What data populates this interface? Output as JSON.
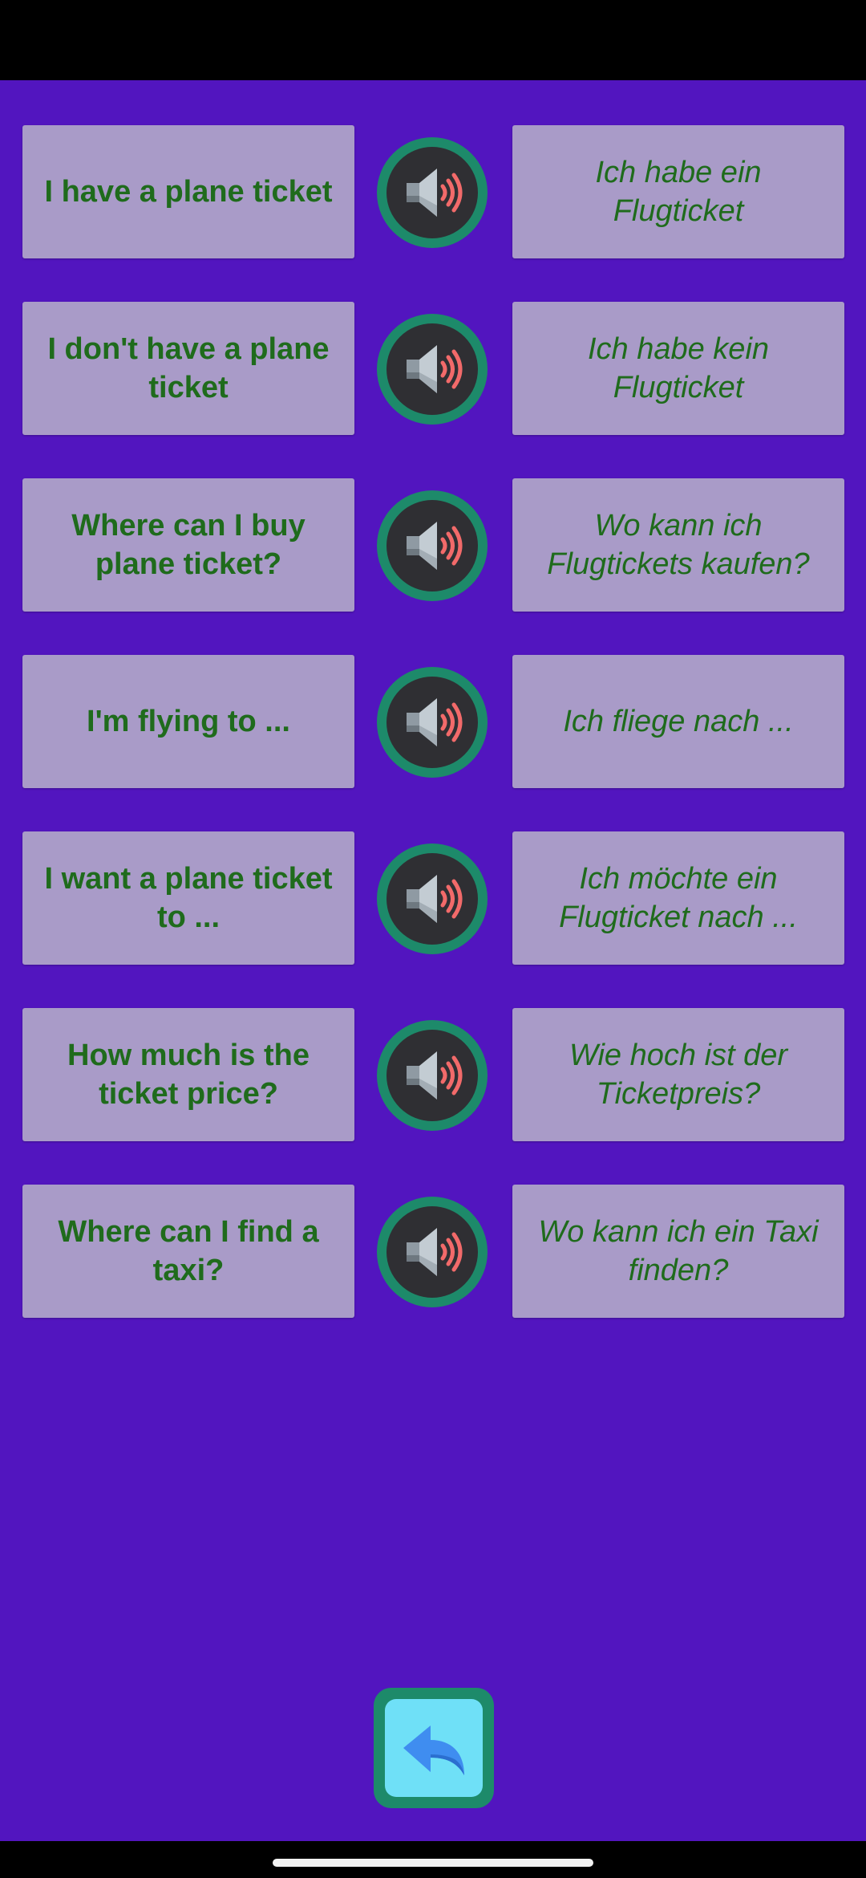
{
  "colors": {
    "background": "#5215bf",
    "card": "#a99bc8",
    "text": "#1f6b1c",
    "speaker_ring": "#1d8a6a",
    "speaker_body": "#2f2f33",
    "sound_waves": "#f26a6a",
    "back_button_fill": "#6fe0f7",
    "back_arrow": "#3f8df0"
  },
  "phrases": [
    {
      "en": "I have a plane ticket",
      "de": "Ich habe ein Flugticket",
      "icon": "speaker-icon"
    },
    {
      "en": "I don't have a plane ticket",
      "de": "Ich habe kein Flugticket",
      "icon": "speaker-icon"
    },
    {
      "en": "Where can I buy plane ticket?",
      "de": "Wo kann ich Flugtickets kaufen?",
      "icon": "speaker-icon"
    },
    {
      "en": "I'm flying to ...",
      "de": "Ich fliege nach ...",
      "icon": "speaker-icon"
    },
    {
      "en": "I want a plane ticket to ...",
      "de": "Ich möchte ein Flugticket nach ...",
      "icon": "speaker-icon"
    },
    {
      "en": "How much is the ticket price?",
      "de": "Wie hoch ist der Ticketpreis?",
      "icon": "speaker-icon"
    },
    {
      "en": "Where can I find a taxi?",
      "de": "Wo kann ich ein Taxi finden?",
      "icon": "speaker-icon"
    }
  ],
  "back_button": {
    "icon": "back-arrow-icon"
  }
}
